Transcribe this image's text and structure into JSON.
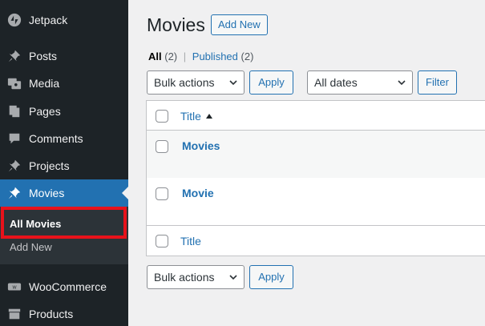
{
  "sidebar": {
    "items": [
      {
        "label": "Jetpack",
        "icon": "jetpack-icon"
      },
      {
        "label": "Posts",
        "icon": "pin-icon"
      },
      {
        "label": "Media",
        "icon": "media-icon"
      },
      {
        "label": "Pages",
        "icon": "pages-icon"
      },
      {
        "label": "Comments",
        "icon": "comment-icon"
      },
      {
        "label": "Projects",
        "icon": "pin-icon"
      },
      {
        "label": "Movies",
        "icon": "pin-icon"
      },
      {
        "label": "WooCommerce",
        "icon": "woo-icon"
      },
      {
        "label": "Products",
        "icon": "archive-icon"
      }
    ],
    "submenu": {
      "all_movies": "All Movies",
      "add_new": "Add New"
    }
  },
  "header": {
    "title": "Movies",
    "add_new": "Add New"
  },
  "views": {
    "all_label": "All",
    "all_count": "(2)",
    "separator": "|",
    "published_label": "Published",
    "published_count": "(2)"
  },
  "filters": {
    "bulk_actions": "Bulk actions",
    "apply": "Apply",
    "dates": "All dates",
    "filter": "Filter"
  },
  "table": {
    "column_title": "Title",
    "rows": [
      {
        "title": "Movies"
      },
      {
        "title": "Movie"
      }
    ],
    "footer_title": "Title"
  },
  "bottom": {
    "bulk_actions": "Bulk actions",
    "apply": "Apply"
  },
  "colors": {
    "accent": "#2271b1",
    "sidebar": "#1d2327",
    "highlight": "#e8121b"
  }
}
